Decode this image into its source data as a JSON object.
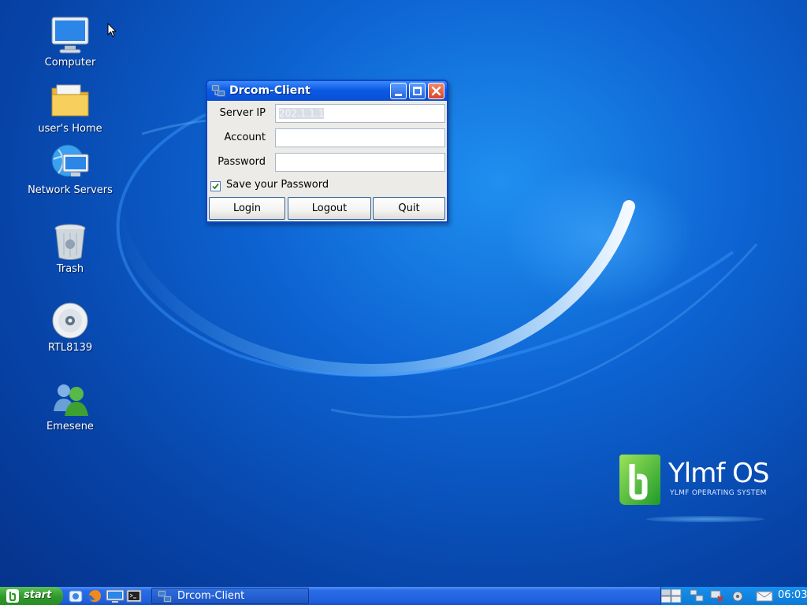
{
  "desktop": {
    "icons": [
      {
        "label": "Computer",
        "icon": "computer-icon"
      },
      {
        "label": "user's Home",
        "icon": "home-folder-icon"
      },
      {
        "label": "Network Servers",
        "icon": "network-servers-icon"
      },
      {
        "label": "Trash",
        "icon": "trash-icon"
      },
      {
        "label": "RTL8139",
        "icon": "cd-drive-icon"
      },
      {
        "label": "Emesene",
        "icon": "emesene-icon"
      }
    ],
    "logo": {
      "brand": "Ylmf OS",
      "tagline": "YLMF OPERATING SYSTEM"
    }
  },
  "window": {
    "title": "Drcom-Client",
    "fields": {
      "server_ip_label": "Server IP",
      "server_ip_value": "202.1.1.1",
      "account_label": "Account",
      "account_value": "",
      "password_label": "Password",
      "password_value": ""
    },
    "save_password": {
      "label": "Save your Password",
      "checked": true
    },
    "buttons": {
      "login": "Login",
      "logout": "Logout",
      "quit": "Quit"
    }
  },
  "taskbar": {
    "start_label": "start",
    "task_label": "Drcom-Client",
    "clock": "06:03"
  },
  "colors": {
    "taskbar_blue": "#1f5fdd",
    "start_green": "#2f9a2b",
    "title_blue": "#0b5ae6",
    "close_red": "#d8432a"
  }
}
